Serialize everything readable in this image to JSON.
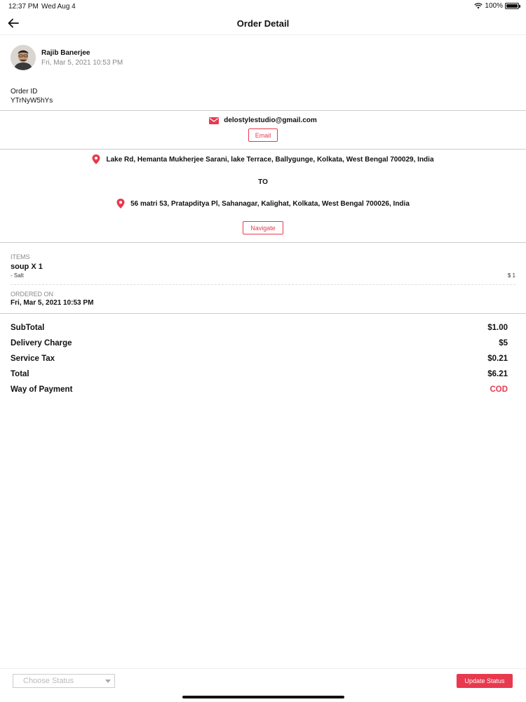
{
  "status_bar": {
    "time": "12:37 PM",
    "date": "Wed Aug 4",
    "battery": "100%"
  },
  "header": {
    "title": "Order Detail"
  },
  "customer": {
    "name": "Rajib Banerjee",
    "date": "Fri, Mar 5, 2021 10:53 PM"
  },
  "order": {
    "id_label": "Order ID",
    "id": "YTrNyW5hYs"
  },
  "contact": {
    "email": "delostylestudio@gmail.com",
    "email_button": "Email"
  },
  "route": {
    "from": "Lake Rd, Hemanta Mukherjee Sarani, lake Terrace, Ballygunge, Kolkata, West Bengal 700029, India",
    "to_label": "TO",
    "to": "56 matri 53, Pratapditya Pl, Sahanagar, Kalighat, Kolkata, West Bengal 700026, India",
    "navigate_button": "Navigate"
  },
  "items": {
    "label": "ITEMS",
    "list": [
      {
        "name": "soup X 1",
        "modifier": "- Salt",
        "price": "$ 1"
      }
    ]
  },
  "ordered_on": {
    "label": "ORDERED ON",
    "value": "Fri, Mar 5, 2021 10:53 PM"
  },
  "summary": [
    {
      "label": "SubTotal",
      "value": "$1.00"
    },
    {
      "label": "Delivery Charge",
      "value": "$5"
    },
    {
      "label": "Service Tax",
      "value": "$0.21"
    },
    {
      "label": "Total",
      "value": "$6.21"
    },
    {
      "label": "Way of Payment",
      "value": "COD"
    }
  ],
  "footer": {
    "status_placeholder": "Choose Status",
    "update_button": "Update Status"
  },
  "colors": {
    "accent": "#e8394f"
  }
}
